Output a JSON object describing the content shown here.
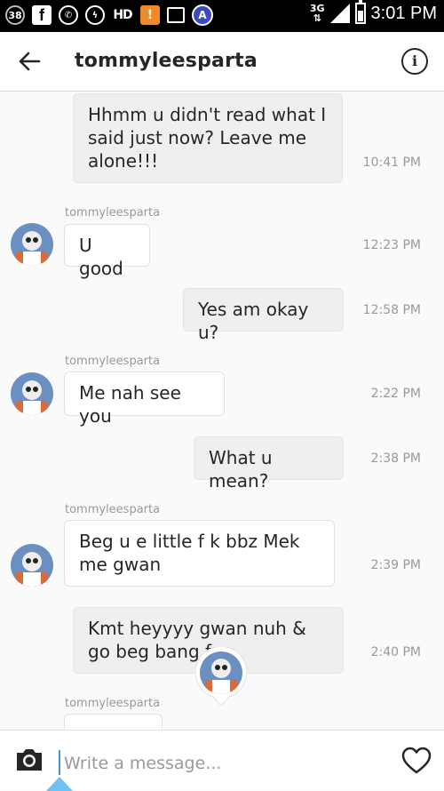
{
  "status_bar": {
    "notification_count": "38",
    "hd_label": "HD",
    "network": "3G",
    "time": "3:01 PM"
  },
  "header": {
    "title": "tommyleesparta"
  },
  "messages": [
    {
      "direction": "out",
      "text": "Hhmm u didn't read what I said just now? Leave me alone!!!",
      "time": "10:41 PM"
    },
    {
      "direction": "in",
      "sender": "tommyleesparta",
      "text": "U good",
      "time": "12:23 PM"
    },
    {
      "direction": "out",
      "text": "Yes am okay u?",
      "time": "12:58 PM"
    },
    {
      "direction": "in",
      "sender": "tommyleesparta",
      "text": "Me nah see you",
      "time": "2:22 PM"
    },
    {
      "direction": "out",
      "text": "What u mean?",
      "time": "2:38 PM"
    },
    {
      "direction": "in",
      "sender": "tommyleesparta",
      "text": "Beg u e little f k bbz Mek me gwan",
      "time": "2:39 PM"
    },
    {
      "direction": "out",
      "text": "Kmt heyyyy gwan nuh & go beg bang f",
      "time": "2:40 PM"
    },
    {
      "direction": "in",
      "sender": "tommyleesparta",
      "text": "",
      "time": ""
    }
  ],
  "composer": {
    "placeholder": "Write a message..."
  },
  "colors": {
    "status_bar_bg": "#000000",
    "outgoing_bubble": "#efefef",
    "incoming_bubble": "#ffffff",
    "cursor": "#4a90e2"
  },
  "icons": [
    "back-arrow-icon",
    "info-icon",
    "camera-icon",
    "heart-icon"
  ]
}
